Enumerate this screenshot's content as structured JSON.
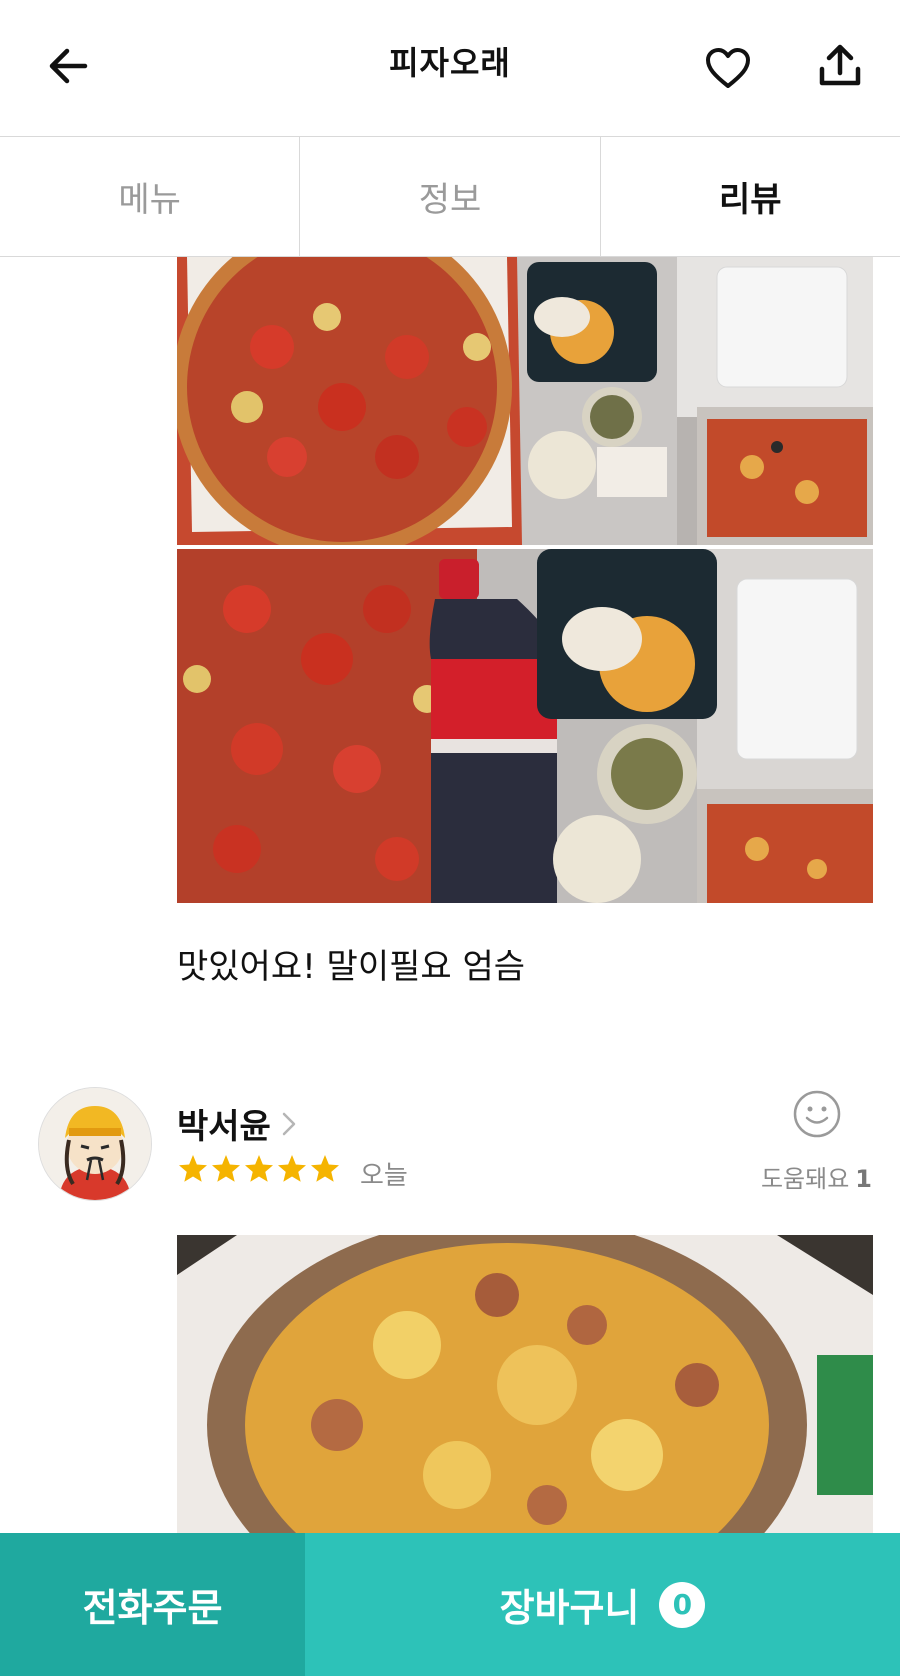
{
  "header": {
    "title": "피자오래",
    "back_icon": "arrow-left-icon",
    "favorite_icon": "heart-icon",
    "share_icon": "share-icon"
  },
  "tabs": [
    {
      "label": "메뉴",
      "active": false
    },
    {
      "label": "정보",
      "active": false
    },
    {
      "label": "리뷰",
      "active": true
    }
  ],
  "reviews": [
    {
      "text": "맛있어요! 말이필요 엄슴"
    },
    {
      "name": "박서윤",
      "rating": 5,
      "date": "오늘",
      "helpful_label": "도움돼요",
      "helpful_count": "1"
    }
  ],
  "bottom_bar": {
    "phone_order_label": "전화주문",
    "cart_label": "장바구니",
    "cart_count": "0"
  },
  "colors": {
    "accent": "#2dc2b8",
    "accent_dark": "#1fa99f",
    "star": "#f5b400"
  }
}
